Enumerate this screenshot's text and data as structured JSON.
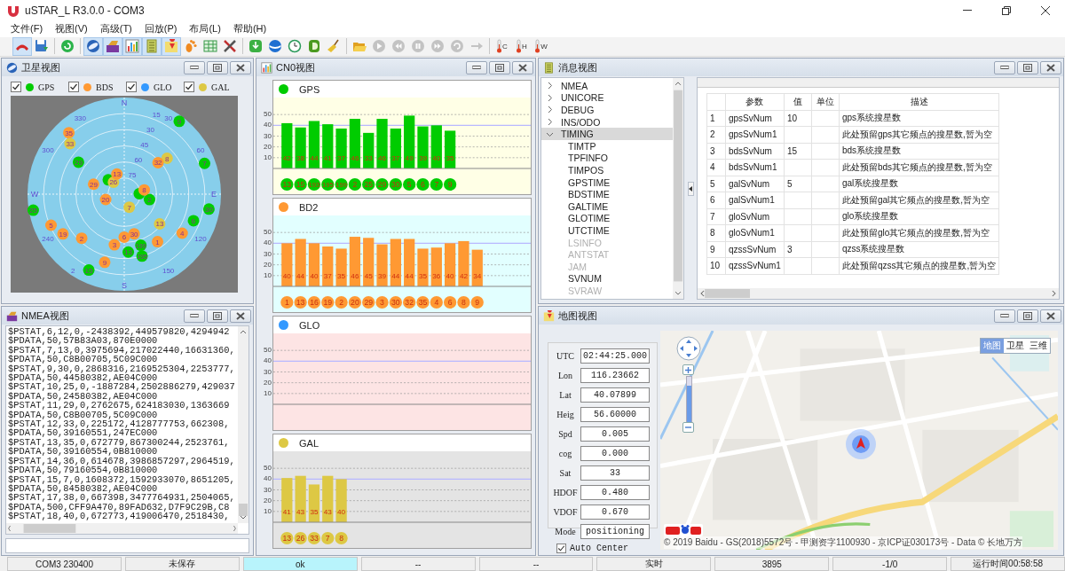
{
  "window": {
    "title": "uSTAR_L R3.0.0 - COM3"
  },
  "menu": [
    "文件(F)",
    "视图(V)",
    "高级(T)",
    "回放(P)",
    "布局(L)",
    "帮助(H)"
  ],
  "toolbar": [
    {
      "pressed": true,
      "disabled": false
    },
    {
      "pressed": false,
      "disabled": false
    },
    {
      "pressed": false,
      "disabled": false
    },
    {
      "pressed": true,
      "disabled": false
    },
    {
      "pressed": true,
      "disabled": false
    },
    {
      "pressed": true,
      "disabled": false
    },
    {
      "pressed": true,
      "disabled": false
    },
    {
      "pressed": true,
      "disabled": false
    },
    {
      "pressed": false,
      "disabled": false
    },
    {
      "pressed": false,
      "disabled": false
    },
    {
      "pressed": false,
      "disabled": false
    },
    {
      "pressed": false,
      "disabled": false
    },
    {
      "pressed": false,
      "disabled": false
    },
    {
      "pressed": false,
      "disabled": false
    },
    {
      "pressed": false,
      "disabled": false
    },
    {
      "pressed": false,
      "disabled": false
    },
    {
      "pressed": false,
      "disabled": false
    },
    {
      "pressed": false,
      "disabled": true
    },
    {
      "pressed": false,
      "disabled": true
    },
    {
      "pressed": false,
      "disabled": true
    },
    {
      "pressed": false,
      "disabled": true
    },
    {
      "pressed": false,
      "disabled": true
    },
    {
      "pressed": false,
      "disabled": true
    },
    {
      "pressed": false,
      "disabled": false,
      "label": "C"
    },
    {
      "pressed": false,
      "disabled": false,
      "label": "H"
    },
    {
      "pressed": false,
      "disabled": false,
      "label": "W"
    }
  ],
  "satellite_view": {
    "title": "卫星视图",
    "legend": [
      {
        "label": "GPS",
        "color": "#00cc00",
        "checked": true
      },
      {
        "label": "BDS",
        "color": "#ff9933",
        "checked": true
      },
      {
        "label": "GLO",
        "color": "#3399ff",
        "checked": true
      },
      {
        "label": "GAL",
        "color": "#ddc844",
        "checked": true
      }
    ],
    "compass": [
      "N",
      "E",
      "S",
      "W"
    ],
    "elevation_labels": [
      "75",
      "60",
      "45",
      "30",
      "15"
    ],
    "azimuth_labels": [
      "330",
      "30",
      "300",
      "60",
      "240",
      "120",
      "2",
      "150"
    ],
    "satellites": [
      {
        "prn": "9",
        "color": "#00cc00"
      },
      {
        "prn": "35",
        "color": "#ff9933"
      },
      {
        "prn": "33",
        "color": "#ddc844"
      },
      {
        "prn": "29",
        "color": "#00cc00"
      },
      {
        "prn": "8",
        "color": "#ddc844"
      },
      {
        "prn": "32",
        "color": "#ff9933"
      },
      {
        "prn": "7",
        "color": "#00cc00"
      },
      {
        "color": "#00cc00"
      },
      {
        "prn": "26",
        "color": "#ddc844"
      },
      {
        "prn": "13",
        "color": "#ff9933"
      },
      {
        "prn": "29",
        "color": "#ff9933"
      },
      {
        "color": "#00cc00"
      },
      {
        "prn": "2",
        "color": "#00cc00"
      },
      {
        "prn": "8",
        "color": "#ff9933"
      },
      {
        "prn": "20",
        "color": "#ff9933"
      },
      {
        "prn": "7",
        "color": "#ddc844"
      },
      {
        "prn": "25",
        "color": "#00cc00"
      },
      {
        "prn": "30",
        "color": "#00cc00"
      },
      {
        "prn": "6",
        "color": "#00cc00"
      },
      {
        "prn": "13",
        "color": "#ddc844"
      },
      {
        "prn": "5",
        "color": "#ff9933"
      },
      {
        "prn": "19",
        "color": "#ff9933"
      },
      {
        "prn": "4",
        "color": "#ff9933"
      },
      {
        "prn": "2",
        "color": "#ff9933"
      },
      {
        "prn": "6",
        "color": "#ff9933"
      },
      {
        "prn": "30",
        "color": "#ff9933"
      },
      {
        "prn": "3",
        "color": "#ff9933"
      },
      {
        "prn": "199",
        "color": "#00cc00"
      },
      {
        "prn": "1",
        "color": "#ff9933"
      },
      {
        "prn": "13",
        "color": "#00cc00"
      },
      {
        "prn": "195",
        "color": "#00cc00"
      },
      {
        "prn": "9",
        "color": "#ff9933"
      },
      {
        "prn": "15",
        "color": "#00cc00"
      }
    ]
  },
  "cn0_view": {
    "title": "CN0视图",
    "systems": [
      {
        "name": "GPS",
        "color": "#00cc00",
        "chart_data": {
          "type": "bar",
          "categories": [
            "13",
            "15",
            "193",
            "195",
            "199",
            "2",
            "25",
            "29",
            "30",
            "5",
            "6",
            "7",
            "9"
          ],
          "series": [
            {
              "color": "#00cc00",
              "values": [
                42,
                38,
                44,
                41,
                37,
                46,
                33,
                46,
                37,
                49,
                39,
                40,
                35
              ]
            }
          ],
          "ylim": [
            -25.5,
            81.4
          ],
          "yticks": [
            10,
            20,
            30,
            40,
            50
          ],
          "grid": true,
          "ref_lines": [
            {
              "axis": "y",
              "value": 40
            }
          ],
          "data_labels": true
        }
      },
      {
        "name": "BD2",
        "color": "#ff9933",
        "chart_data": {
          "type": "bar",
          "categories": [
            "1",
            "13",
            "16",
            "19",
            "2",
            "20",
            "29",
            "3",
            "30",
            "32",
            "35",
            "4",
            "6",
            "8",
            "9"
          ],
          "series": [
            {
              "color": "#ff9933",
              "values": [
                40,
                44,
                40,
                37,
                35,
                46,
                45,
                39,
                44,
                44,
                35,
                36,
                40,
                42,
                34
              ]
            }
          ],
          "ylim": [
            -25.5,
            81.4
          ],
          "yticks": [
            10,
            20,
            30,
            40,
            50
          ],
          "grid": true,
          "ref_lines": [
            {
              "axis": "y",
              "value": 40
            }
          ],
          "data_labels": true
        }
      },
      {
        "name": "GLO",
        "color": "#3399ff",
        "axis_labels": [
          "50",
          "40",
          "30",
          "20",
          "10"
        ]
      },
      {
        "name": "GAL",
        "color": "#ddc844",
        "chart_data": {
          "type": "bar",
          "categories": [
            "13",
            "26",
            "33",
            "7",
            "8"
          ],
          "series": [
            {
              "color": "#ddc844",
              "values": [
                41,
                43,
                35,
                43,
                40
              ]
            }
          ],
          "ylim": [
            -25.5,
            81.4
          ],
          "yticks": [
            10,
            20,
            30,
            40,
            50
          ],
          "grid": true,
          "ref_lines": [
            {
              "axis": "y",
              "value": 40
            }
          ],
          "data_labels": true
        }
      }
    ]
  },
  "message_view": {
    "title": "消息视图",
    "tree": [
      {
        "label": "NMEA",
        "expanded": false,
        "selected": false
      },
      {
        "label": "UNICORE",
        "expanded": false,
        "selected": false
      },
      {
        "label": "DEBUG",
        "expanded": false,
        "selected": false
      },
      {
        "label": "INS/ODO",
        "expanded": false,
        "selected": false
      },
      {
        "label": "TIMING",
        "expanded": true,
        "selected": true,
        "children": [
          {
            "label": "TIMTP",
            "disabled": false,
            "selected": false
          },
          {
            "label": "TPFINFO",
            "disabled": false,
            "selected": false
          },
          {
            "label": "TIMPOS",
            "disabled": false,
            "selected": false
          },
          {
            "label": "GPSTIME",
            "disabled": false,
            "selected": false
          },
          {
            "label": "BDSTIME",
            "disabled": false,
            "selected": false
          },
          {
            "label": "GALTIME",
            "disabled": false,
            "selected": false
          },
          {
            "label": "GLOTIME",
            "disabled": false,
            "selected": false
          },
          {
            "label": "UTCTIME",
            "disabled": false,
            "selected": false
          },
          {
            "label": "LSINFO",
            "disabled": true,
            "selected": false
          },
          {
            "label": "ANTSTAT",
            "disabled": true,
            "selected": false
          },
          {
            "label": "JAM",
            "disabled": true,
            "selected": false
          },
          {
            "label": "SVNUM",
            "disabled": false,
            "selected": false
          },
          {
            "label": "SVRAW",
            "disabled": true,
            "selected": false
          }
        ]
      }
    ],
    "table": {
      "columns": [
        "参数",
        "值",
        "单位",
        "描述"
      ],
      "rows": [
        {
          "index": "1",
          "parameter": "gpsSvNum",
          "value": "10",
          "description": "gps系统搜星数"
        },
        {
          "index": "2",
          "parameter": "gpsSvNum1",
          "description": "此处预留gps其它频点的搜星数,暂为空"
        },
        {
          "index": "3",
          "parameter": "bdsSvNum",
          "value": "15",
          "description": "bds系统搜星数"
        },
        {
          "index": "4",
          "parameter": "bdsSvNum1",
          "description": "此处预留bds其它频点的搜星数,暂为空"
        },
        {
          "index": "5",
          "parameter": "galSvNum",
          "value": "5",
          "description": "gal系统搜星数"
        },
        {
          "index": "6",
          "parameter": "galSvNum1",
          "description": "此处预留gal其它频点的搜星数,暂为空"
        },
        {
          "index": "7",
          "parameter": "gloSvNum",
          "description": "glo系统搜星数"
        },
        {
          "index": "8",
          "parameter": "gloSvNum1",
          "description": "此处预留glo其它频点的搜星数,暂为空"
        },
        {
          "index": "9",
          "parameter": "qzssSvNum",
          "value": "3",
          "description": "qzss系统搜星数"
        },
        {
          "index": "10",
          "parameter": "qzssSvNum1",
          "description": "此处预留qzss其它频点的搜星数,暂为空"
        }
      ]
    }
  },
  "nmea_view": {
    "title": "NMEA视图",
    "lines": [
      "$PSTAT,6,12,0,-2438392,449579820,4294942",
      "$PDATA,50,57B83A03,870E0000",
      "$PSTAT,7,13,0,3975694,217022440,16631360,",
      "$PDATA,50,C8B00705,5C09C000",
      "$PSTAT,9,30,0,2868316,2169525304,2253777,",
      "$PDATA,50,44580382,AE04C000",
      "$PSTAT,10,25,0,-1887284,2502886279,429037",
      "$PDATA,50,24580382,AE04C000",
      "$PSTAT,11,29,0,2762675,624183030,1363669",
      "$PDATA,50,C8B00705,5C09C000",
      "$PSTAT,12,33,0,225172,4128777753,662308,",
      "$PDATA,50,39160551,247EC000",
      "$PSTAT,13,35,0,672779,867300244,2523761,",
      "$PDATA,50,39160554,0B810000",
      "$PSTAT,14,36,0,614678,3986857297,2964519,",
      "$PDATA,50,79160554,0B810000",
      "$PSTAT,15,7,0,1608372,1592933070,8651205,",
      "$PDATA,50,84580382,AE04C000",
      "$PSTAT,17,38,0,667398,3477764931,2504065,",
      "$PDATA,500,CFF9A470,89FAD632,D7F9C29B,C8",
      "$PSTAT,18,40,0,672773,419006470,2518430,"
    ]
  },
  "map_view": {
    "title": "地图视图",
    "fields": [
      {
        "label": "UTC",
        "value": "02:44:25.000"
      },
      {
        "label": "Lon",
        "value": "116.23662"
      },
      {
        "label": "Lat",
        "value": "40.07899"
      },
      {
        "label": "Heig",
        "value": "56.60000"
      },
      {
        "label": "Spd",
        "value": "0.005"
      },
      {
        "label": "cog",
        "value": "0.000"
      },
      {
        "label": "Sat",
        "value": "33"
      },
      {
        "label": "HDOF",
        "value": "0.480"
      },
      {
        "label": "VDOF",
        "value": "0.670"
      },
      {
        "label": "Mode",
        "value": "positioning"
      }
    ],
    "auto_center": {
      "label": "Auto Center",
      "checked": true
    },
    "zoom": {
      "level": 0.8
    },
    "map_types": [
      {
        "label": "地图",
        "selected": true
      },
      {
        "label": "卫星",
        "selected": false
      },
      {
        "label": "三维",
        "selected": false
      }
    ],
    "copyright": "© 2019 Baidu - GS(2018)5572号 - 甲测资字1100930 - 京ICP证030173号 - Data © 长地万方"
  },
  "status_bar": [
    {
      "text": "COM3 230400",
      "highlighted": false
    },
    {
      "text": "未保存",
      "highlighted": false
    },
    {
      "text": "ok",
      "highlighted": true
    },
    {
      "text": "--",
      "highlighted": false
    },
    {
      "text": "--",
      "highlighted": false
    },
    {
      "text": "实时",
      "highlighted": false
    },
    {
      "text": "3895",
      "highlighted": false
    },
    {
      "text": "-1/0",
      "highlighted": false
    },
    {
      "text": "运行时间00:58:58",
      "highlighted": false
    }
  ]
}
